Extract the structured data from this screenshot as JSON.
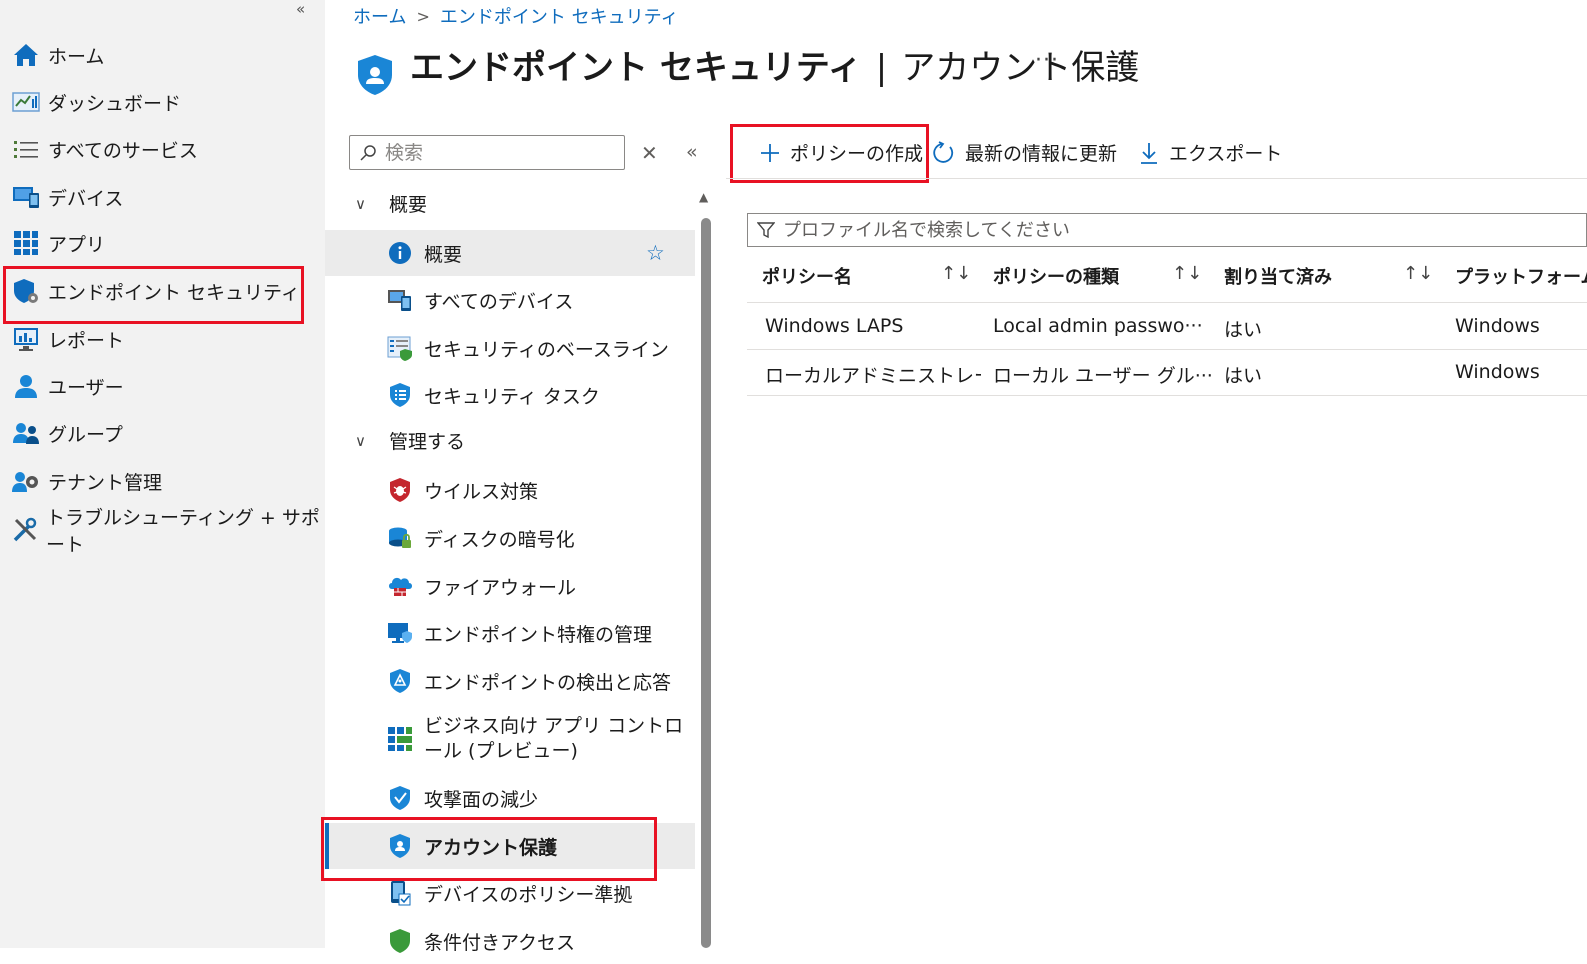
{
  "colors": {
    "accent": "#0f6cbd",
    "highlight_border": "#e81123",
    "nav_bg": "#f2f2f2"
  },
  "left_nav": {
    "collapse": "«",
    "items": [
      {
        "label": "ホーム",
        "icon": "home-icon"
      },
      {
        "label": "ダッシュボード",
        "icon": "dashboard-icon"
      },
      {
        "label": "すべてのサービス",
        "icon": "list-icon"
      },
      {
        "label": "デバイス",
        "icon": "devices-icon"
      },
      {
        "label": "アプリ",
        "icon": "apps-icon"
      },
      {
        "label": "エンドポイント セキュリティ",
        "icon": "endpoint-security-icon",
        "highlighted": true
      },
      {
        "label": "レポート",
        "icon": "reports-icon"
      },
      {
        "label": "ユーザー",
        "icon": "user-icon"
      },
      {
        "label": "グループ",
        "icon": "groups-icon"
      },
      {
        "label": "テナント管理",
        "icon": "tenant-admin-icon"
      },
      {
        "label": "トラブルシューティング + サポート",
        "icon": "troubleshoot-icon"
      }
    ]
  },
  "breadcrumb": {
    "home": "ホーム",
    "separator": ">",
    "current": "エンドポイント セキュリティ"
  },
  "title": {
    "main": "エンドポイント セキュリティ",
    "divider": "|",
    "sub": "アカウント保護",
    "more": "···"
  },
  "subnav": {
    "search_placeholder": "検索",
    "clear": "✕",
    "collapse": "«",
    "sections": [
      {
        "label": "概要",
        "chevron": "∨"
      },
      {
        "label": "管理する",
        "chevron": "∨"
      }
    ],
    "items": [
      {
        "label": "概要",
        "icon": "info-icon",
        "star": "☆"
      },
      {
        "label": "すべてのデバイス",
        "icon": "all-devices-icon"
      },
      {
        "label": "セキュリティのベースライン",
        "icon": "baseline-icon"
      },
      {
        "label": "セキュリティ タスク",
        "icon": "security-tasks-icon"
      },
      {
        "label": "ウイルス対策",
        "icon": "antivirus-icon"
      },
      {
        "label": "ディスクの暗号化",
        "icon": "disk-encryption-icon"
      },
      {
        "label": "ファイアウォール",
        "icon": "firewall-icon"
      },
      {
        "label": "エンドポイント特権の管理",
        "icon": "privilege-icon"
      },
      {
        "label": "エンドポイントの検出と応答",
        "icon": "edr-icon"
      },
      {
        "label_line1": "ビジネス向け アプリ コントロ",
        "label_line2": "ール (プレビュー)",
        "icon": "app-control-icon"
      },
      {
        "label": "攻撃面の減少",
        "icon": "asr-icon"
      },
      {
        "label": "アカウント保護",
        "icon": "account-protection-icon",
        "active": true
      },
      {
        "label": "デバイスのポリシー準拠",
        "icon": "compliance-icon"
      },
      {
        "label": "条件付きアクセス",
        "icon": "conditional-access-icon"
      }
    ]
  },
  "toolbar": {
    "create": "ポリシーの作成",
    "refresh": "最新の情報に更新",
    "export": "エクスポート"
  },
  "filter": {
    "placeholder": "プロファイル名で検索してください"
  },
  "table": {
    "sort_glyph": "↑↓",
    "columns": [
      "ポリシー名",
      "ポリシーの種類",
      "割り当て済み",
      "プラットフォーム"
    ],
    "rows": [
      [
        "Windows LAPS",
        "Local admin passwo···",
        "はい",
        "Windows"
      ],
      [
        "ローカルアドミニストレータの変",
        "ローカル ユーザー グル···",
        "はい",
        "Windows"
      ]
    ]
  }
}
